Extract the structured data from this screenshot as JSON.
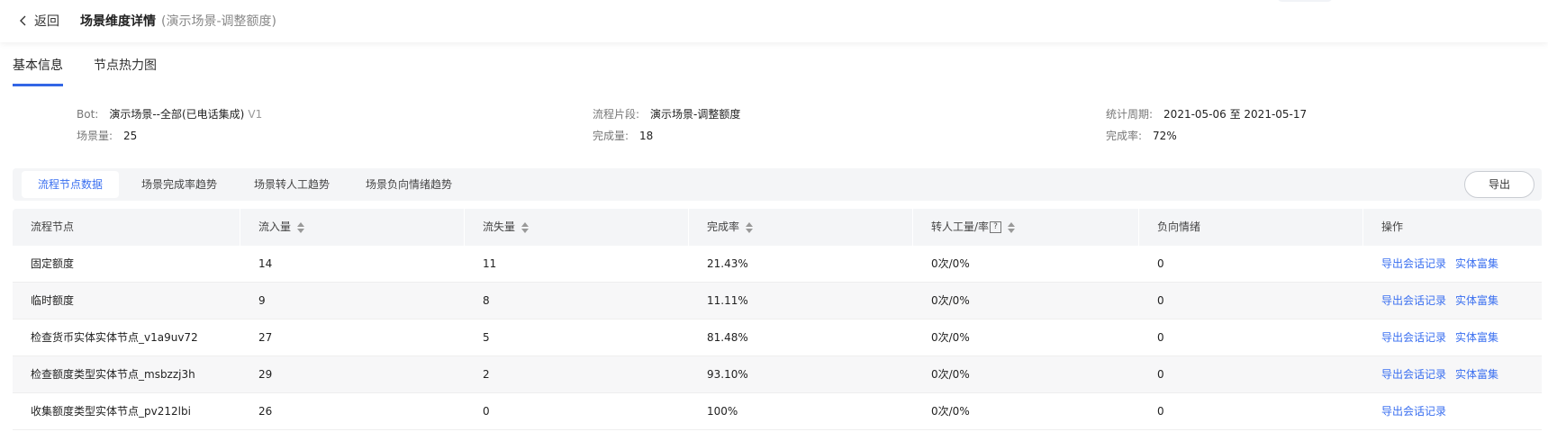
{
  "header": {
    "back_label": "返回",
    "title": "场景维度详情",
    "subtitle": "(演示场景-调整额度)"
  },
  "tabs": [
    {
      "label": "基本信息",
      "active": true
    },
    {
      "label": "节点热力图",
      "active": false
    }
  ],
  "info": {
    "bot_label": "Bot:",
    "bot_value": "演示场景--全部(已电话集成)",
    "bot_version": "V1",
    "flow_label": "流程片段:",
    "flow_value": "演示场景-调整额度",
    "period_label": "统计周期:",
    "period_value": "2021-05-06 至 2021-05-17",
    "scene_count_label": "场景量:",
    "scene_count_value": "25",
    "completed_label": "完成量:",
    "completed_value": "18",
    "rate_label": "完成率:",
    "rate_value": "72%"
  },
  "subtabs": [
    {
      "label": "流程节点数据",
      "active": true
    },
    {
      "label": "场景完成率趋势",
      "active": false
    },
    {
      "label": "场景转人工趋势",
      "active": false
    },
    {
      "label": "场景负向情绪趋势",
      "active": false
    }
  ],
  "export_label": "导出",
  "table": {
    "headers": {
      "node": "流程节点",
      "inflow": "流入量",
      "loss": "流失量",
      "rate": "完成率",
      "transfer": "转人工量/率",
      "transfer_help": "?",
      "negative": "负向情绪",
      "ops": "操作"
    },
    "op_export": "导出会话记录",
    "op_entity": "实体富集",
    "rows": [
      {
        "node": "固定额度",
        "inflow": "14",
        "loss": "11",
        "rate": "21.43%",
        "transfer": "0次/0%",
        "negative": "0",
        "has_entity": true
      },
      {
        "node": "临时额度",
        "inflow": "9",
        "loss": "8",
        "rate": "11.11%",
        "transfer": "0次/0%",
        "negative": "0",
        "has_entity": true
      },
      {
        "node": "检查货币实体实体节点_v1a9uv72",
        "inflow": "27",
        "loss": "5",
        "rate": "81.48%",
        "transfer": "0次/0%",
        "negative": "0",
        "has_entity": true
      },
      {
        "node": "检查额度类型实体节点_msbzzj3h",
        "inflow": "29",
        "loss": "2",
        "rate": "93.10%",
        "transfer": "0次/0%",
        "negative": "0",
        "has_entity": true
      },
      {
        "node": "收集额度类型实体节点_pv212lbi",
        "inflow": "26",
        "loss": "0",
        "rate": "100%",
        "transfer": "0次/0%",
        "negative": "0",
        "has_entity": false
      }
    ]
  },
  "colors": {
    "accent": "#3a6ff0",
    "tab_underline": "#3366e6"
  }
}
